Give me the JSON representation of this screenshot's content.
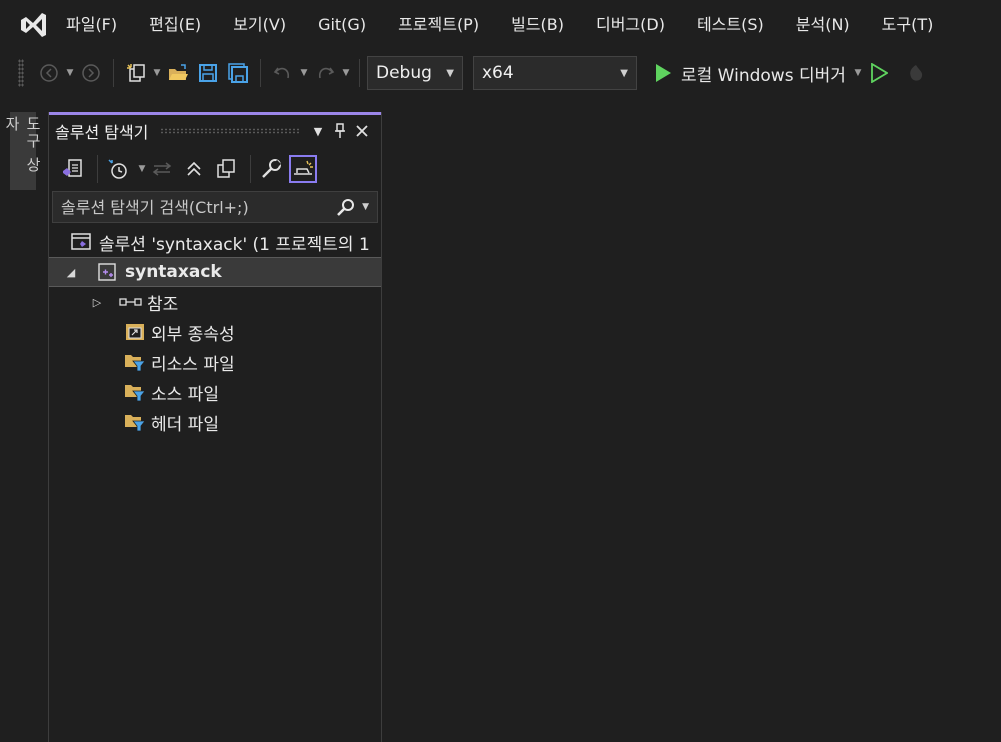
{
  "menu": {
    "items": [
      "파일(F)",
      "편집(E)",
      "보기(V)",
      "Git(G)",
      "프로젝트(P)",
      "빌드(B)",
      "디버그(D)",
      "테스트(S)",
      "분석(N)",
      "도구(T)"
    ]
  },
  "toolbar": {
    "config": "Debug",
    "platform": "x64",
    "run_label": "로컬 Windows 디버거"
  },
  "toolstrip": {
    "label": "도구 상자"
  },
  "solution_explorer": {
    "title": "솔루션 탐색기",
    "search_placeholder": "솔루션 탐색기 검색(Ctrl+;)",
    "solution_label": "솔루션 'syntaxack'  (1 프로젝트의 1",
    "project": "syntaxack",
    "nodes": [
      "참조",
      "외부 종속성",
      "리소스 파일",
      "소스 파일",
      "헤더 파일"
    ]
  },
  "colors": {
    "accent": "#9b86e8",
    "run_green": "#5fd35f",
    "folder": "#d9b05a",
    "filter_blue": "#4aa3e8"
  }
}
